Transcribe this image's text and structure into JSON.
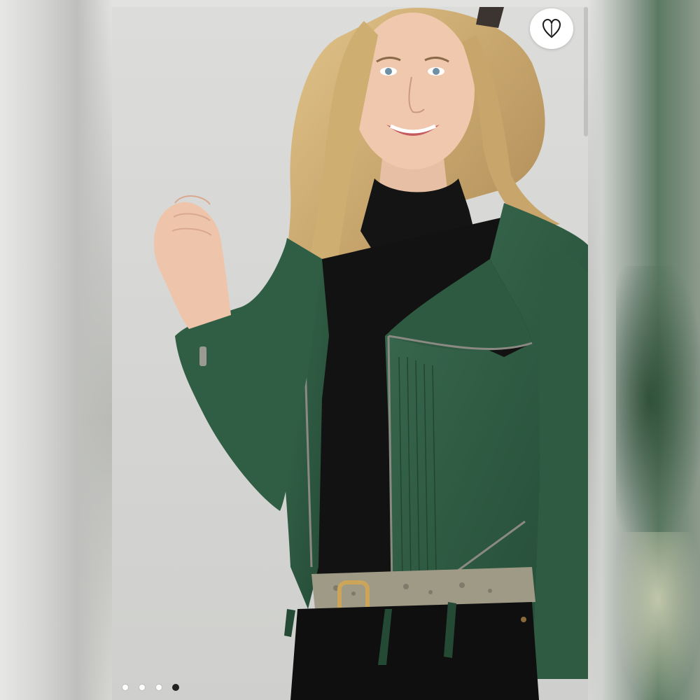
{
  "product_image": {
    "subject": "woman-in-green-suede-moto-jacket",
    "colors": {
      "jacket": "#2f5c43",
      "turtleneck": "#111111",
      "backdrop": "#d6d7d4",
      "hair": "#c9a46a"
    }
  },
  "favorite": {
    "icon": "heart-outline-icon"
  },
  "carousel": {
    "total": 4,
    "active_index": 3
  }
}
